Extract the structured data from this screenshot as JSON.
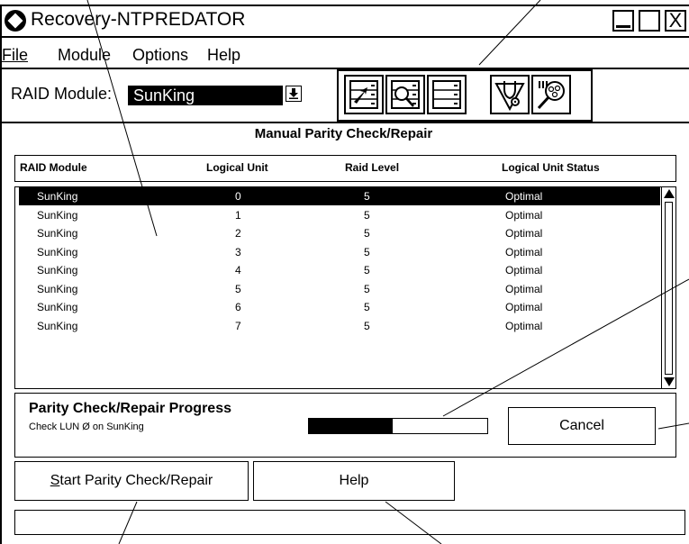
{
  "window": {
    "title": "Recovery-NTPREDATOR"
  },
  "titlebar": {
    "close_glyph": "X"
  },
  "menu": [
    {
      "label": "File"
    },
    {
      "label": "Module"
    },
    {
      "label": "Options"
    },
    {
      "label": "Help"
    }
  ],
  "raid_selector": {
    "label": "RAID Module:",
    "value": "SunKing"
  },
  "toolbar": {
    "icons": [
      "configuration-icon",
      "status-icon",
      "recovery-icon",
      "maintenance-icon",
      "tuning-icon"
    ]
  },
  "section": {
    "title": "Manual Parity Check/Repair"
  },
  "table": {
    "columns": [
      "RAID Module",
      "Logical Unit",
      "Raid Level",
      "Logical Unit Status"
    ],
    "rows": [
      [
        "SunKing",
        "0",
        "5",
        "Optimal"
      ],
      [
        "SunKing",
        "1",
        "5",
        "Optimal"
      ],
      [
        "SunKing",
        "2",
        "5",
        "Optimal"
      ],
      [
        "SunKing",
        "3",
        "5",
        "Optimal"
      ],
      [
        "SunKing",
        "4",
        "5",
        "Optimal"
      ],
      [
        "SunKing",
        "5",
        "5",
        "Optimal"
      ],
      [
        "SunKing",
        "6",
        "5",
        "Optimal"
      ],
      [
        "SunKing",
        "7",
        "5",
        "Optimal"
      ]
    ],
    "selected_index": 0
  },
  "progress": {
    "title": "Parity Check/Repair Progress",
    "subtitle": "Check LUN Ø on SunKing",
    "fraction": 0.47
  },
  "buttons": {
    "cancel": "Cancel",
    "start": "Start Parity Check/Repair",
    "help": "Help"
  },
  "colors": {
    "foreground": "#000000",
    "background": "#ffffff"
  }
}
